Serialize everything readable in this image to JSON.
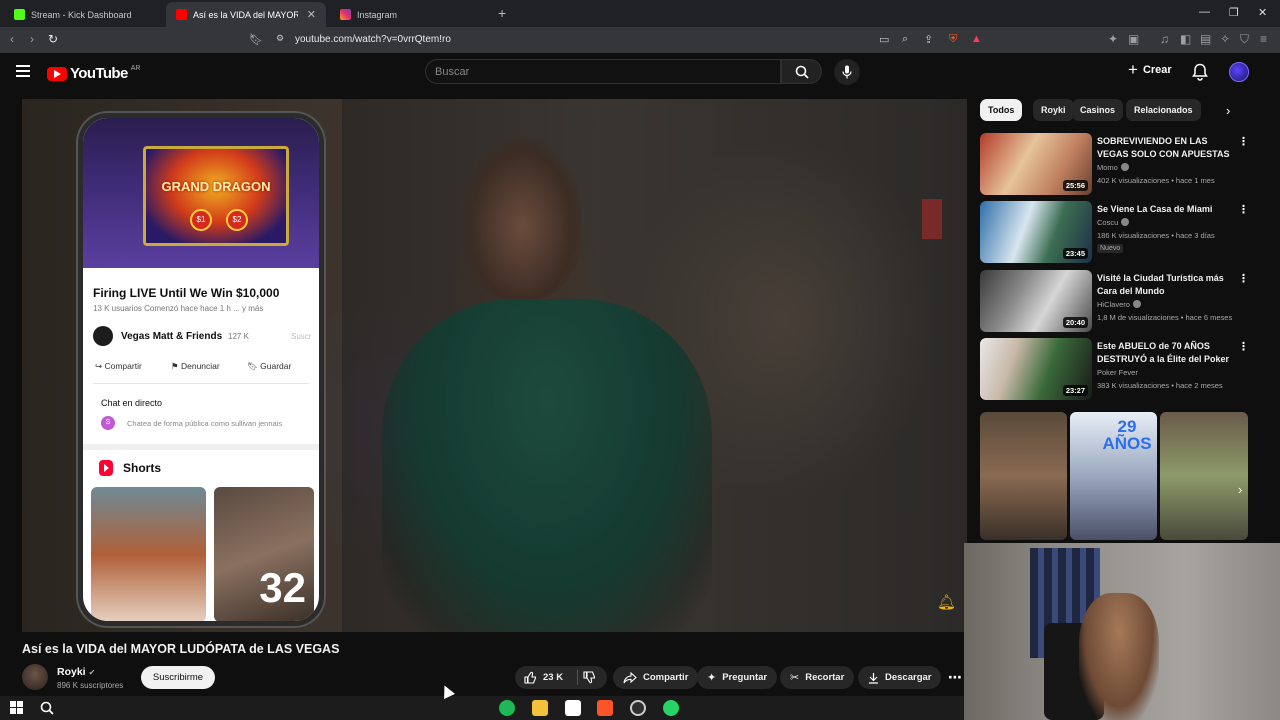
{
  "browser": {
    "tabs": [
      {
        "title": "Stream - Kick Dashboard",
        "color": "#53fc18"
      },
      {
        "title": "Así es la VIDA del MAYOR LU...",
        "color": "#ff0000"
      },
      {
        "title": "Instagram",
        "color": "#e1306c"
      }
    ],
    "url": "youtube.com/watch?v=0vrrQtem!ro"
  },
  "yt": {
    "logo_text": "YouTube",
    "country": "AR",
    "search_placeholder": "Buscar",
    "create_label": "Crear"
  },
  "phone": {
    "slot_title": "GRAND DRAGON",
    "slot_b1": "$1",
    "slot_b2": "$2",
    "title": "Firing LIVE Until We Win $10,000",
    "meta": "13 K usuarios   Comenzó hace hace 1 h   ... y más",
    "channel": "Vegas Matt & Friends",
    "subs": "127 K",
    "subscribe_cut": "Suscr",
    "actions": [
      "Compartir",
      "Denunciar",
      "Guardar"
    ],
    "chat_title": "Chat en directo",
    "chat_avatar": "S",
    "chat_input": "Chatea de forma pública como sullivan jennais",
    "shorts_title": "Shorts",
    "short2_number": "32"
  },
  "video": {
    "title": "Así es la VIDA del MAYOR LUDÓPATA de LAS VEGAS",
    "channel": "Royki",
    "subscribers": "896 K suscriptores",
    "subscribe_label": "Suscribirme",
    "likes": "23 K",
    "actions": {
      "share": "Compartir",
      "ask": "Preguntar",
      "clip": "Recortar",
      "download": "Descargar"
    }
  },
  "chips": [
    "Todos",
    "Royki",
    "Casinos",
    "Relacionados"
  ],
  "recommended": [
    {
      "title": "SOBREVIVIENDO EN LAS VEGAS SOLO CON APUESTAS",
      "channel": "Momo",
      "views": "402 K visualizaciones • hace 1 mes",
      "duration": "25:56",
      "badge": ""
    },
    {
      "title": "Se Viene La Casa de Miami",
      "channel": "Coscu",
      "views": "186 K visualizaciones • hace 3 días",
      "duration": "23:45",
      "badge": "Nuevo"
    },
    {
      "title": "Visité la Ciudad Turística más Cara del Mundo",
      "channel": "HiClavero",
      "views": "1,8 M de visualizaciones • hace 6 meses",
      "duration": "20:40",
      "badge": ""
    },
    {
      "title": "Este ABUELO de 70 AÑOS DESTRUYÓ a la Élite del Poker",
      "channel": "Poker Fever",
      "views": "383 K visualizaciones • hace 2 meses",
      "duration": "23:27",
      "badge": ""
    }
  ],
  "shorts_row": {
    "short2_text": "29 AÑOS"
  }
}
